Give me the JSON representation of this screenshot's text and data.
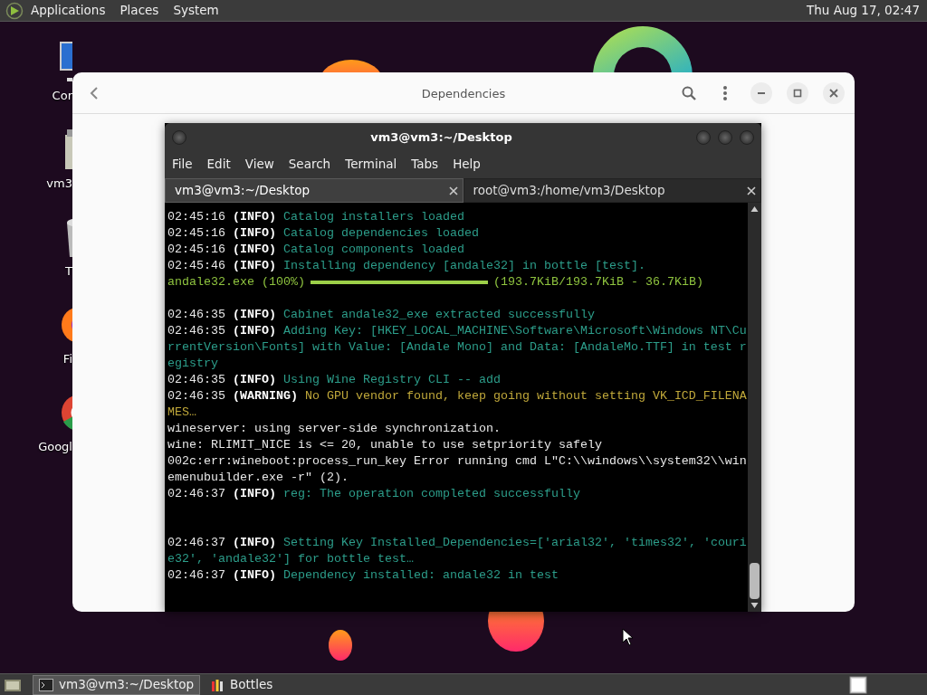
{
  "top_panel": {
    "menus": [
      "Applications",
      "Places",
      "System"
    ],
    "clock": "Thu Aug 17, 02:47"
  },
  "desktop_icons": [
    {
      "kind": "monitor",
      "label": "Cor"
    },
    {
      "kind": "home",
      "label": "vm3"
    },
    {
      "kind": "trash",
      "label": "T"
    },
    {
      "kind": "firefox",
      "label": "Fi"
    },
    {
      "kind": "chrome",
      "label": "Googl"
    }
  ],
  "bottles_window": {
    "title": "Dependencies"
  },
  "terminal": {
    "title": "vm3@vm3:~/Desktop",
    "menu": [
      "File",
      "Edit",
      "View",
      "Search",
      "Terminal",
      "Tabs",
      "Help"
    ],
    "tabs": [
      {
        "label": "vm3@vm3:~/Desktop",
        "selected": true
      },
      {
        "label": "root@vm3:/home/vm3/Desktop",
        "selected": false
      }
    ],
    "lines": [
      {
        "kind": "log",
        "time": "02:45:16",
        "level": "(INFO)",
        "color": "#2c9d8a",
        "message": "Catalog installers loaded"
      },
      {
        "kind": "log",
        "time": "02:45:16",
        "level": "(INFO)",
        "color": "#2c9d8a",
        "message": "Catalog dependencies loaded"
      },
      {
        "kind": "log",
        "time": "02:45:16",
        "level": "(INFO)",
        "color": "#2c9d8a",
        "message": "Catalog components loaded"
      },
      {
        "kind": "log",
        "time": "02:45:46",
        "level": "(INFO)",
        "color": "#2c9d8a",
        "message": "Installing dependency [andale32] in bottle [test]."
      },
      {
        "kind": "progress",
        "label": "andale32.exe (100%)",
        "level": 1,
        "reading": "(193.7KiB/193.7KiB - 36.7KiB)"
      },
      {
        "kind": "blank"
      },
      {
        "kind": "log",
        "time": "02:46:35",
        "level": "(INFO)",
        "color": "#2c9d8a",
        "message": "Cabinet andale32_exe extracted successfully"
      },
      {
        "kind": "log",
        "time": "02:46:35",
        "level": "(INFO)",
        "color": "#2c9d8a",
        "message": "Adding Key: [HKEY_LOCAL_MACHINE\\Software\\Microsoft\\Windows NT\\CurrentVersion\\Fonts] with Value: [Andale Mono] and Data: [AndaleMo.TTF] in test registry"
      },
      {
        "kind": "log",
        "time": "02:46:35",
        "level": "(INFO)",
        "color": "#2c9d8a",
        "message": "Using Wine Registry CLI -- add"
      },
      {
        "kind": "log",
        "time": "02:46:35",
        "level": "(WARNING)",
        "color": "#c0a83a",
        "message": "No GPU vendor found, keep going without setting VK_ICD_FILENAMES…"
      },
      {
        "kind": "plain",
        "text": "wineserver: using server-side synchronization."
      },
      {
        "kind": "plain",
        "text": "wine: RLIMIT_NICE is <= 20, unable to use setpriority safely"
      },
      {
        "kind": "plain",
        "text": "002c:err:wineboot:process_run_key Error running cmd L\"C:\\\\windows\\\\system32\\\\winemenubuilder.exe -r\" (2)."
      },
      {
        "kind": "log",
        "time": "02:46:37",
        "level": "(INFO)",
        "color": "#2c9d8a",
        "message": "reg: The operation completed successfully"
      },
      {
        "kind": "blank"
      },
      {
        "kind": "blank"
      },
      {
        "kind": "log",
        "time": "02:46:37",
        "level": "(INFO)",
        "color": "#2c9d8a",
        "message": "Setting Key Installed_Dependencies=['arial32', 'times32', 'courie32', 'andale32'] for bottle test…"
      },
      {
        "kind": "log",
        "time": "02:46:37",
        "level": "(INFO)",
        "color": "#2c9d8a",
        "message": "Dependency installed: andale32 in test"
      }
    ]
  },
  "taskbar": {
    "items": [
      {
        "kind": "terminal",
        "label": "vm3@vm3:~/Desktop",
        "selected": true
      },
      {
        "kind": "bottles",
        "label": "Bottles",
        "selected": false
      }
    ]
  }
}
